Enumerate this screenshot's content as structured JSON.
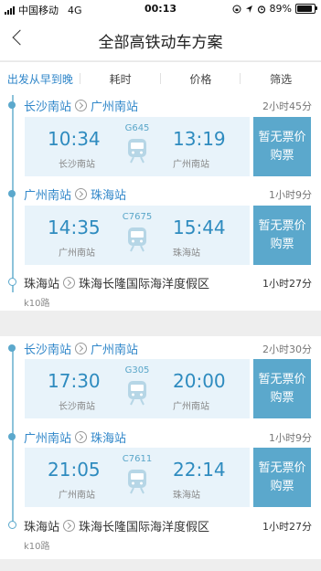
{
  "status": {
    "carrier": "中国移动",
    "network": "4G",
    "time": "00:13",
    "battery": "89%"
  },
  "nav": {
    "title": "全部高铁动车方案"
  },
  "tabs": [
    {
      "label": "出发从早到晚",
      "active": true
    },
    {
      "label": "耗时",
      "active": false
    },
    {
      "label": "价格",
      "active": false
    },
    {
      "label": "筛选",
      "active": false
    }
  ],
  "colors": {
    "accent": "#2f86c9",
    "button": "#5ba8cc",
    "card_bg": "#e8f3fa"
  },
  "plans": [
    {
      "legs": [
        {
          "from": "长沙南站",
          "to": "广州南站",
          "duration": "2小时45分",
          "train_no": "G645",
          "dep_time": "10:34",
          "dep_station": "长沙南站",
          "arr_time": "13:19",
          "arr_station": "广州南站",
          "buy_line1": "暂无票价",
          "buy_line2": "购票"
        },
        {
          "from": "广州南站",
          "to": "珠海站",
          "duration": "1小时9分",
          "train_no": "C7675",
          "dep_time": "14:35",
          "dep_station": "广州南站",
          "arr_time": "15:44",
          "arr_station": "珠海站",
          "buy_line1": "暂无票价",
          "buy_line2": "购票"
        }
      ],
      "transfer": {
        "from": "珠海站",
        "to": "珠海长隆国际海洋度假区",
        "duration": "1小时27分",
        "bus": "k10路"
      }
    },
    {
      "legs": [
        {
          "from": "长沙南站",
          "to": "广州南站",
          "duration": "2小时30分",
          "train_no": "G305",
          "dep_time": "17:30",
          "dep_station": "长沙南站",
          "arr_time": "20:00",
          "arr_station": "广州南站",
          "buy_line1": "暂无票价",
          "buy_line2": "购票"
        },
        {
          "from": "广州南站",
          "to": "珠海站",
          "duration": "1小时9分",
          "train_no": "C7611",
          "dep_time": "21:05",
          "dep_station": "广州南站",
          "arr_time": "22:14",
          "arr_station": "珠海站",
          "buy_line1": "暂无票价",
          "buy_line2": "购票"
        }
      ],
      "transfer": {
        "from": "珠海站",
        "to": "珠海长隆国际海洋度假区",
        "duration": "1小时27分",
        "bus": "k10路"
      }
    }
  ]
}
